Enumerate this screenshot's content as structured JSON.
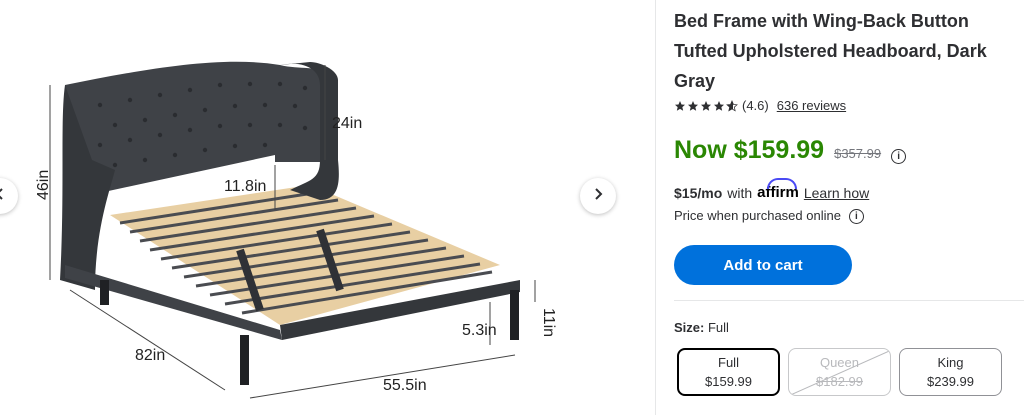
{
  "product": {
    "title": "Bed Frame with Wing-Back Button Tufted Upholstered Headboard, Dark Gray",
    "rating_value": "(4.6)",
    "reviews_label": "636 reviews",
    "now_price": "Now $159.99",
    "was_price": "$357.99",
    "affirm_prefix": "$15/mo",
    "affirm_with": "with",
    "affirm_brand": "affirm",
    "learn_how": "Learn how",
    "online_note": "Price when purchased online",
    "add_to_cart": "Add to cart",
    "size_label": "Size:",
    "size_value": "Full"
  },
  "size_options": [
    {
      "name": "Full",
      "price": "$159.99",
      "state": "selected"
    },
    {
      "name": "Queen",
      "price": "$182.99",
      "state": "unavailable"
    },
    {
      "name": "King",
      "price": "$239.99",
      "state": "available"
    }
  ],
  "image_dimensions": {
    "height_total": "46in",
    "headboard": "24in",
    "clearance": "11.8in",
    "leg_clearance": "11in",
    "leg_height": "5.3in",
    "length": "82in",
    "width": "55.5in"
  },
  "colors": {
    "price_green": "#2a8703",
    "cart_blue": "#0071dc",
    "frame_gray": "#3f4247",
    "slat_wood": "#e8cfa3"
  },
  "icons": [
    "chevron-left-icon",
    "chevron-right-icon",
    "star-icon",
    "info-icon"
  ]
}
